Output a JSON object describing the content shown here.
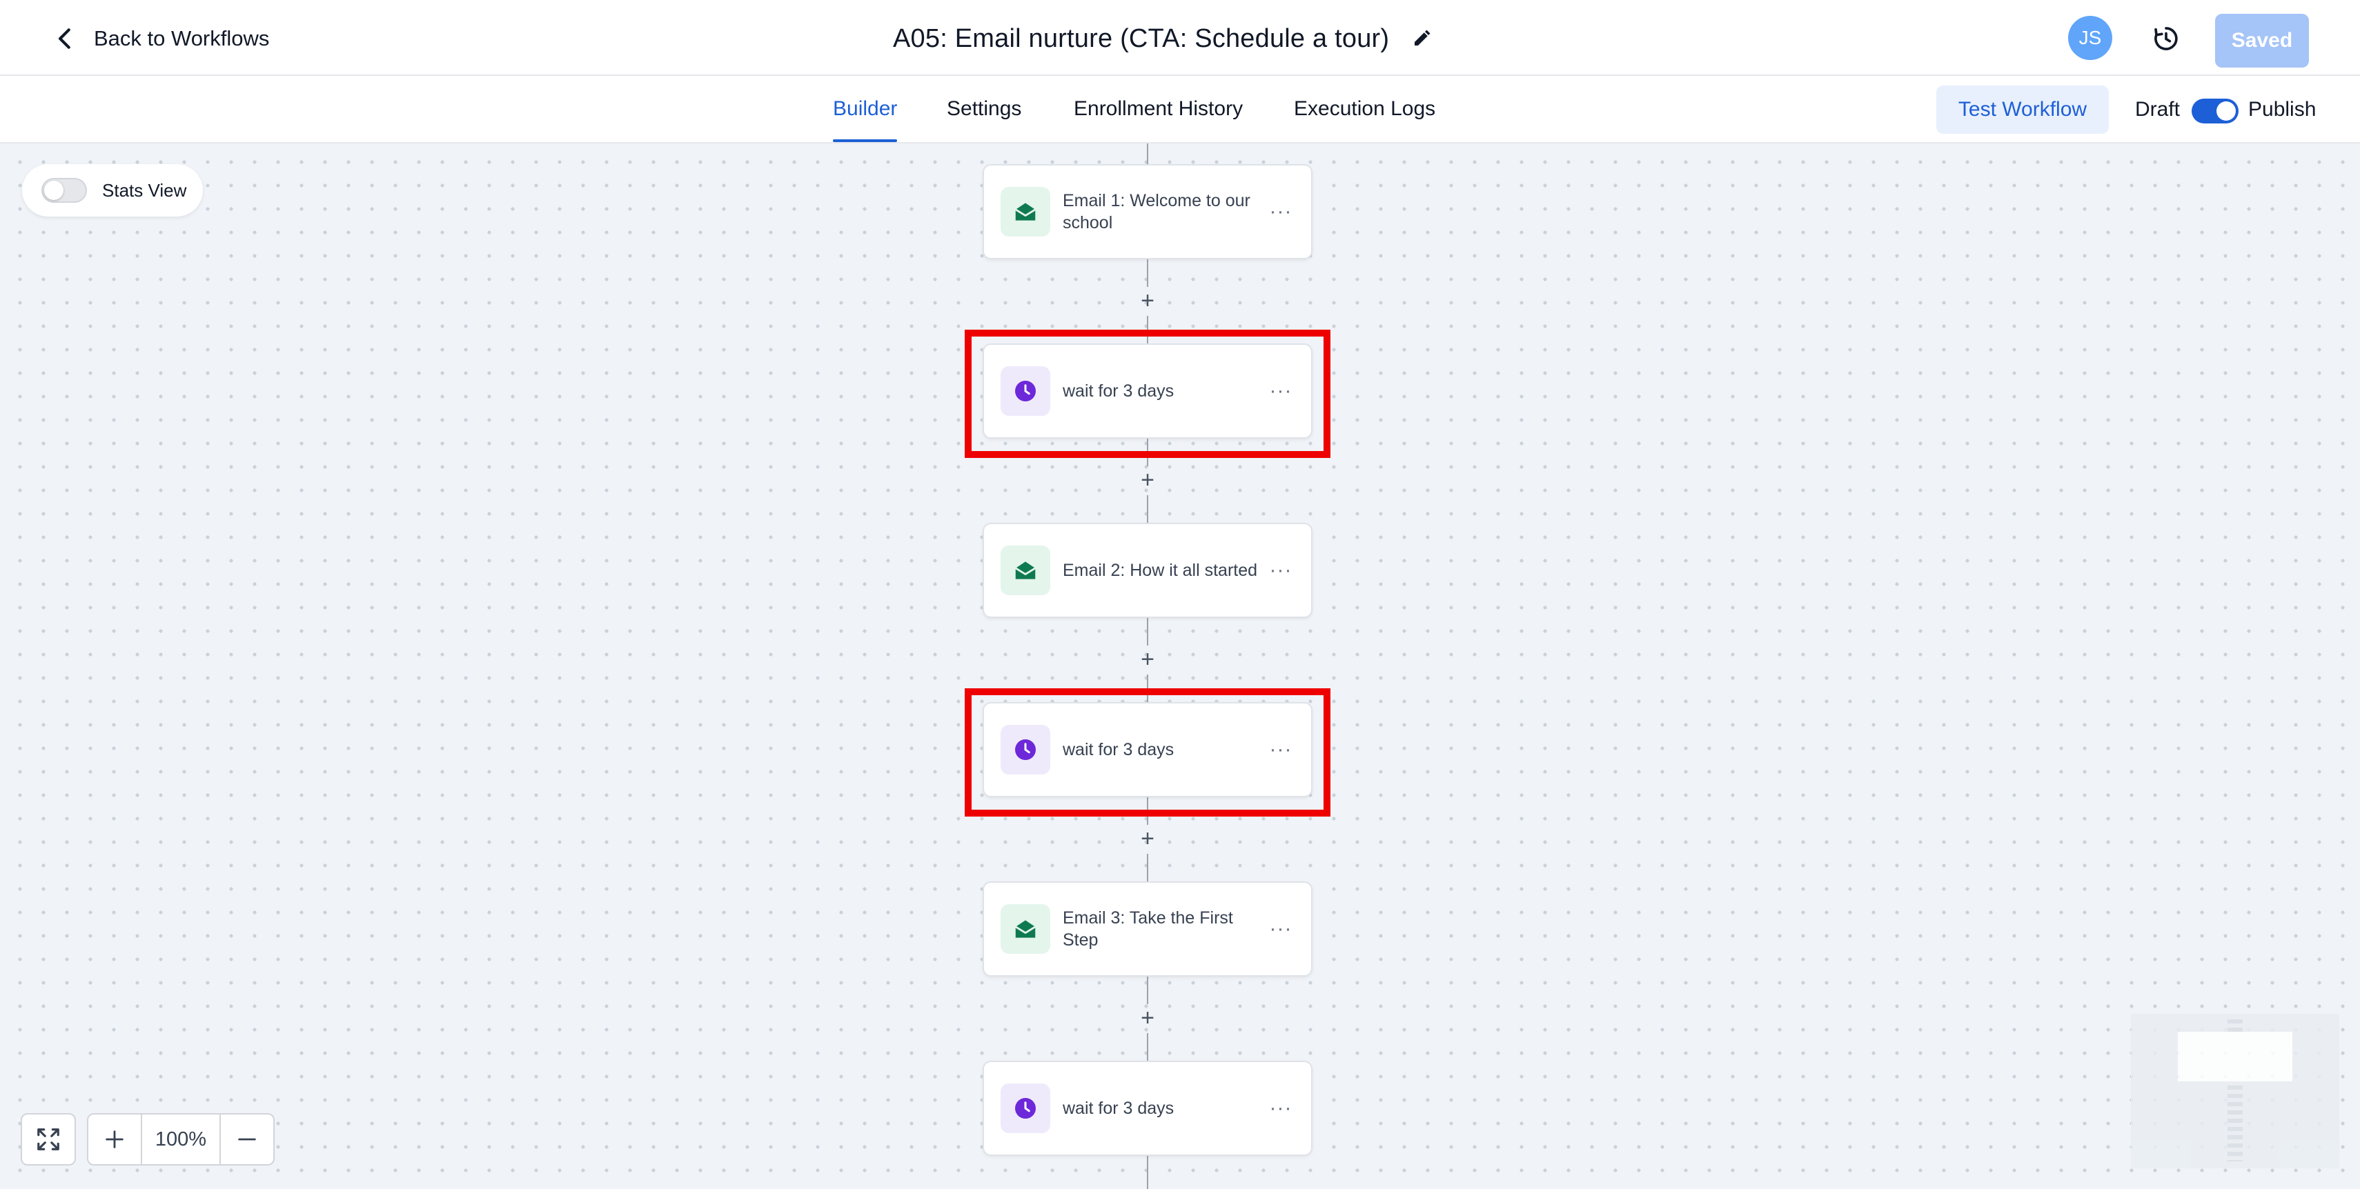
{
  "header": {
    "back_label": "Back to Workflows",
    "title": "A05: Email nurture (CTA: Schedule a tour)",
    "avatar_initials": "JS",
    "saved_label": "Saved"
  },
  "tabs": [
    {
      "label": "Builder",
      "active": true
    },
    {
      "label": "Settings",
      "active": false
    },
    {
      "label": "Enrollment History",
      "active": false
    },
    {
      "label": "Execution Logs",
      "active": false
    }
  ],
  "actions": {
    "test_label": "Test Workflow",
    "draft_label": "Draft",
    "publish_label": "Publish",
    "publish_on": true
  },
  "canvas": {
    "stats_view_label": "Stats View",
    "stats_view_on": false,
    "zoom_level": "100%",
    "plus_symbol": "+",
    "menu_symbol": "···"
  },
  "nodes": [
    {
      "type": "email",
      "icon": "email-open-icon",
      "label": "Email 1: Welcome to our school",
      "highlighted": false
    },
    {
      "type": "wait",
      "icon": "clock-icon",
      "label": "wait for 3 days",
      "highlighted": true
    },
    {
      "type": "email",
      "icon": "email-open-icon",
      "label": "Email 2: How it all started",
      "highlighted": false
    },
    {
      "type": "wait",
      "icon": "clock-icon",
      "label": "wait for 3 days",
      "highlighted": true
    },
    {
      "type": "email",
      "icon": "email-open-icon",
      "label": "Email 3: Take the First Step",
      "highlighted": false
    },
    {
      "type": "wait",
      "icon": "clock-icon",
      "label": "wait for 3 days",
      "highlighted": false
    }
  ],
  "colors": {
    "accent": "#1d5fd6",
    "email_icon": "#0f7a4f",
    "wait_icon": "#6d28d9",
    "highlight": "#ee0000"
  }
}
